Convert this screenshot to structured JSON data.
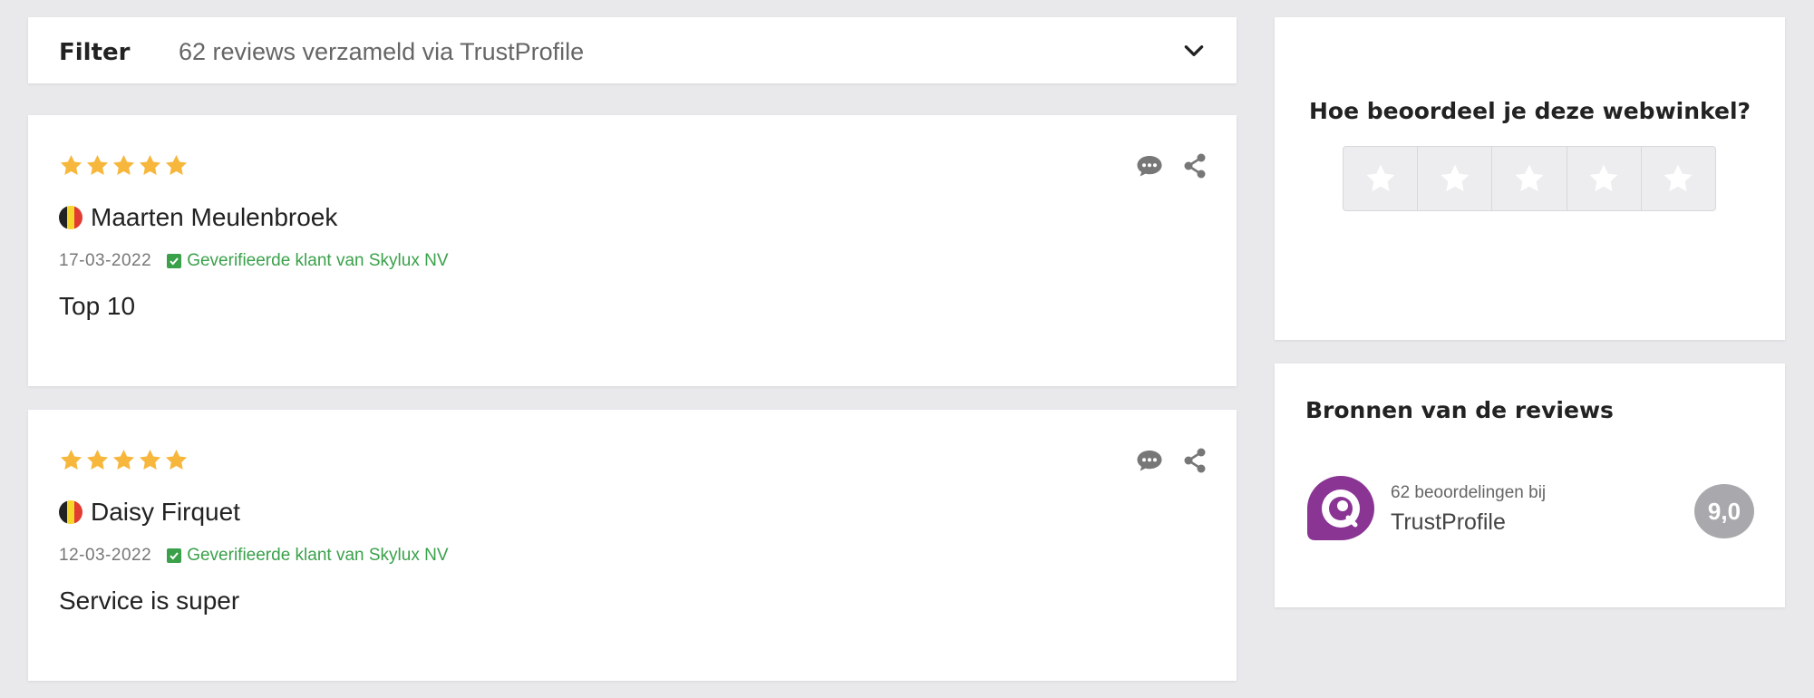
{
  "filter": {
    "label": "Filter",
    "summary": "62 reviews verzameld via TrustProfile",
    "toggle_icon": "chevron-down-icon"
  },
  "reviews": [
    {
      "rating": 5,
      "reviewer": "Maarten Meulenbroek",
      "country_flag": "belgium-flag-icon",
      "date": "17-03-2022",
      "verified": "Geverifieerde klant van Skylux NV",
      "text": "Top 10"
    },
    {
      "rating": 5,
      "reviewer": "Daisy Firquet",
      "country_flag": "belgium-flag-icon",
      "date": "12-03-2022",
      "verified": "Geverifieerde klant van Skylux NV",
      "text": "Service is super"
    }
  ],
  "rate_widget": {
    "title": "Hoe beoordeel je deze webwinkel?",
    "star_count": 5
  },
  "sources": {
    "title": "Bronnen van de reviews",
    "items": [
      {
        "count_label": "62 beoordelingen bij",
        "name": "TrustProfile",
        "score": "9,0",
        "logo_icon": "trustprofile-logo"
      }
    ]
  },
  "colors": {
    "page_background": "#e9e9ec",
    "star": "#f6b73c",
    "verified": "#3aa14a",
    "brand_purple": "#8a3494",
    "score_badge": "#a9a9ad"
  }
}
